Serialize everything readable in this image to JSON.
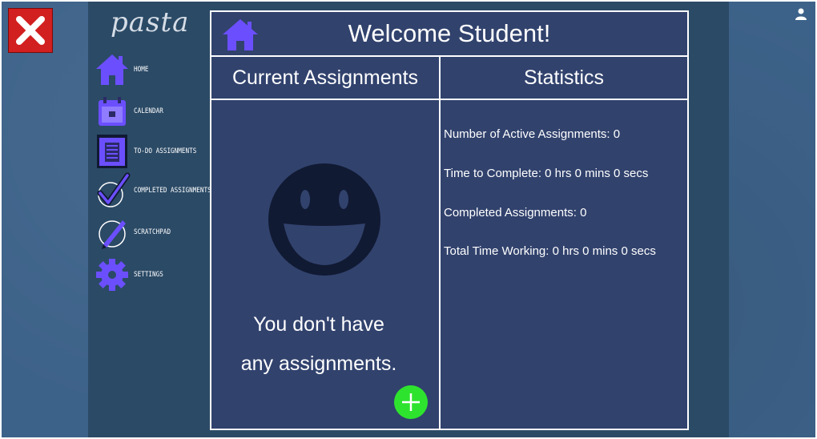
{
  "app": {
    "logo_text": "pasta"
  },
  "close_button": {
    "icon": "close-x-icon",
    "color": "#d21f1f"
  },
  "user_menu": {
    "icon": "user-icon"
  },
  "sidebar": {
    "items": [
      {
        "label": "HOME",
        "icon": "home-icon"
      },
      {
        "label": "CALENDAR",
        "icon": "calendar-icon"
      },
      {
        "label": "TO-DO ASSIGNMENTS",
        "icon": "clipboard-icon"
      },
      {
        "label": "COMPLETED ASSIGNMENTS",
        "icon": "checkmark-icon"
      },
      {
        "label": "SCRATCHPAD",
        "icon": "pen-icon"
      },
      {
        "label": "SETTINGS",
        "icon": "gear-icon"
      }
    ],
    "accent_color": "#6b4fff"
  },
  "main": {
    "title": "Welcome Student!",
    "home_icon": "home-icon",
    "assignments": {
      "heading": "Current Assignments",
      "empty_line1": "You don't have",
      "empty_line2": "any assignments.",
      "add_button_color": "#2ee32e"
    },
    "statistics": {
      "heading": "Statistics",
      "items": [
        "Number of Active Assignments: 0",
        "Time to Complete: 0 hrs 0 mins 0 secs",
        "Completed Assignments: 0",
        "Total Time Working: 0 hrs 0 mins 0 secs"
      ]
    }
  },
  "colors": {
    "background": "#3d6289",
    "panel": "#31426d",
    "text": "#ffffff"
  }
}
